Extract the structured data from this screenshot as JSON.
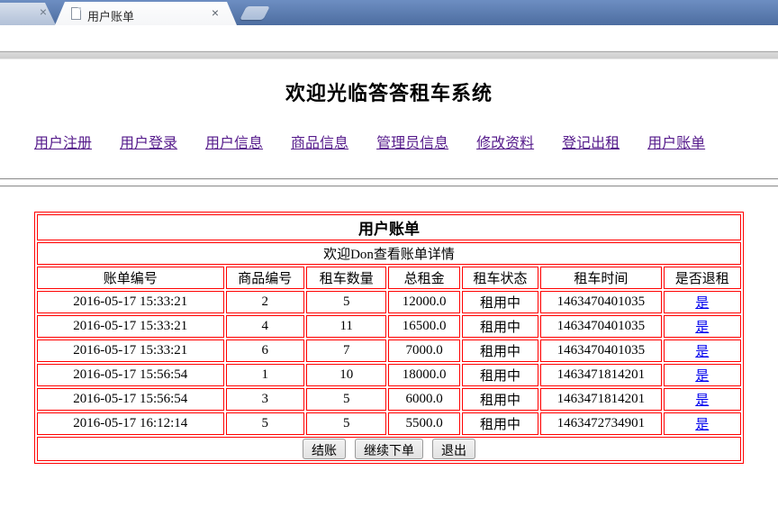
{
  "browser": {
    "active_tab": {
      "title": "用户账单"
    },
    "icons": {
      "close": "×"
    }
  },
  "page": {
    "title": "欢迎光临答答租车系统",
    "nav_links": [
      {
        "id": "register",
        "label": "用户注册"
      },
      {
        "id": "login",
        "label": "用户登录"
      },
      {
        "id": "user-info",
        "label": "用户信息"
      },
      {
        "id": "product-info",
        "label": "商品信息"
      },
      {
        "id": "admin-info",
        "label": "管理员信息"
      },
      {
        "id": "edit-profile",
        "label": "修改资料"
      },
      {
        "id": "register-rental",
        "label": "登记出租"
      },
      {
        "id": "user-bill",
        "label": "用户账单"
      }
    ],
    "bill": {
      "title": "用户账单",
      "subtitle": "欢迎Don查看账单详情",
      "columns": [
        "账单编号",
        "商品编号",
        "租车数量",
        "总租金",
        "租车状态",
        "租车时间",
        "是否退租"
      ],
      "rows": [
        [
          "2016-05-17 15:33:21",
          "2",
          "5",
          "12000.0",
          "租用中",
          "1463470401035",
          "是"
        ],
        [
          "2016-05-17 15:33:21",
          "4",
          "11",
          "16500.0",
          "租用中",
          "1463470401035",
          "是"
        ],
        [
          "2016-05-17 15:33:21",
          "6",
          "7",
          "7000.0",
          "租用中",
          "1463470401035",
          "是"
        ],
        [
          "2016-05-17 15:56:54",
          "1",
          "10",
          "18000.0",
          "租用中",
          "1463471814201",
          "是"
        ],
        [
          "2016-05-17 15:56:54",
          "3",
          "5",
          "6000.0",
          "租用中",
          "1463471814201",
          "是"
        ],
        [
          "2016-05-17 16:12:14",
          "5",
          "5",
          "5500.0",
          "租用中",
          "1463472734901",
          "是"
        ]
      ],
      "buttons": [
        {
          "id": "settle",
          "label": "结账"
        },
        {
          "id": "continue-order",
          "label": "继续下单"
        },
        {
          "id": "exit",
          "label": "退出"
        }
      ]
    },
    "colors": {
      "table_border": "#ff0000",
      "nav_link": "#551a8b",
      "row_link": "#0000ee"
    }
  }
}
